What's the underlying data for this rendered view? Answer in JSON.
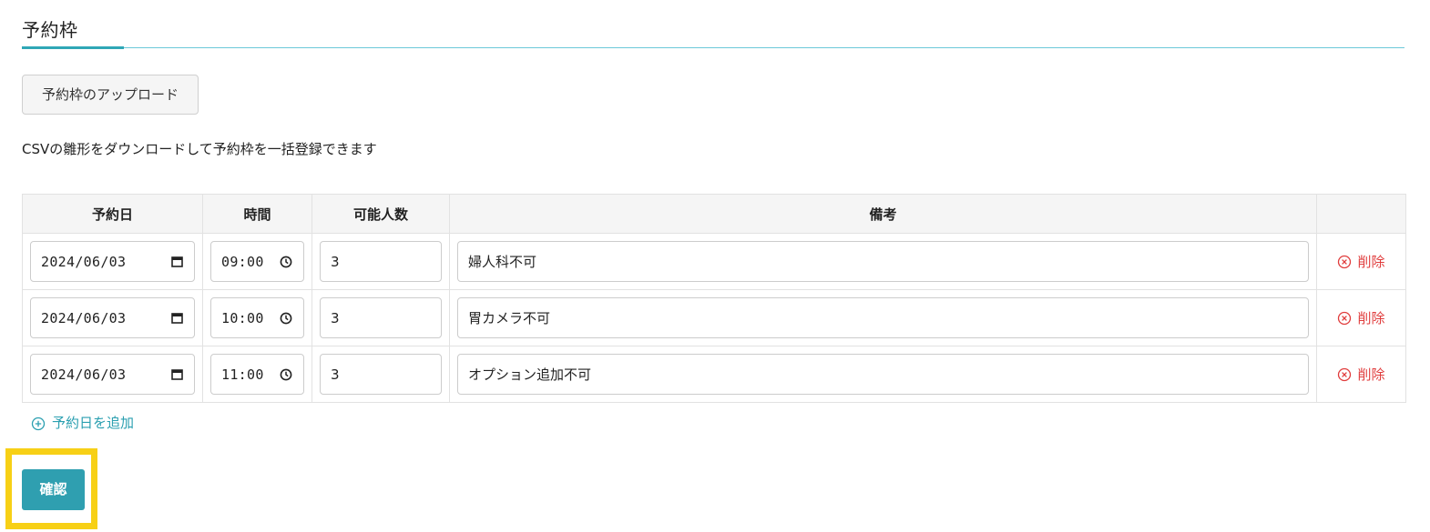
{
  "section": {
    "title": "予約枠"
  },
  "upload_button": {
    "label": "予約枠のアップロード"
  },
  "description": "CSVの雛形をダウンロードして予約枠を一括登録できます",
  "table": {
    "headers": [
      "予約日",
      "時間",
      "可能人数",
      "備考",
      ""
    ],
    "rows": [
      {
        "date": "2024/06/03",
        "time": "09:00",
        "capacity": "3",
        "note": "婦人科不可",
        "delete_label": "削除"
      },
      {
        "date": "2024/06/03",
        "time": "10:00",
        "capacity": "3",
        "note": "胃カメラ不可",
        "delete_label": "削除"
      },
      {
        "date": "2024/06/03",
        "time": "11:00",
        "capacity": "3",
        "note": "オプション追加不可",
        "delete_label": "削除"
      }
    ]
  },
  "add_date": {
    "label": "予約日を追加",
    "icon": "plus-circle-icon"
  },
  "confirm_button": {
    "label": "確認"
  },
  "colors": {
    "accent": "#2f9fb0",
    "delete": "#e03c3c",
    "highlight": "#f7d016",
    "header_bg": "#f5f5f5"
  }
}
